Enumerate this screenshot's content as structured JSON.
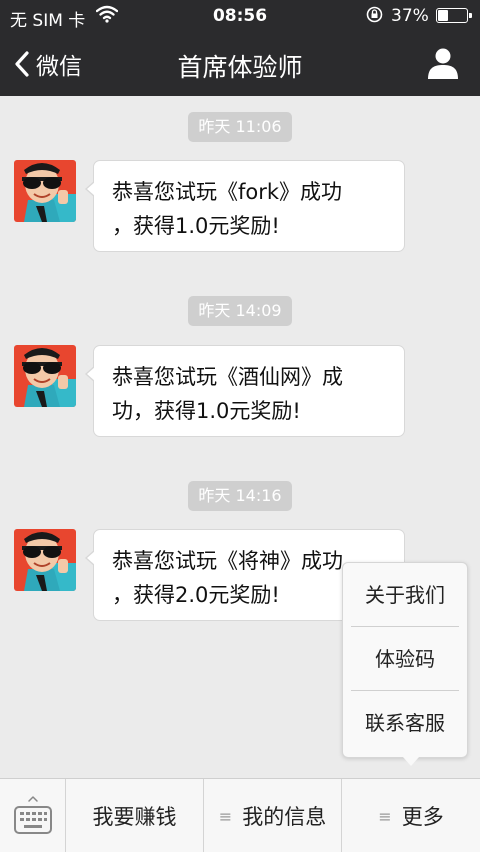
{
  "status_bar": {
    "carrier": "无 SIM 卡",
    "time": "08:56",
    "battery_percent": "37%",
    "battery_level": 0.37
  },
  "nav": {
    "back_label": "微信",
    "title": "首席体验师"
  },
  "messages": [
    {
      "time": "昨天 11:06",
      "line1": "恭喜您试玩《fork》成功",
      "line2": "，获得1.0元奖励!"
    },
    {
      "time": "昨天 14:09",
      "line1": "恭喜您试玩《酒仙网》成",
      "line2": "功，获得1.0元奖励!"
    },
    {
      "time": "昨天 14:16",
      "line1": "恭喜您试玩《将神》成功",
      "line2": "，获得2.0元奖励!"
    }
  ],
  "popup_menu": {
    "items": [
      "关于我们",
      "体验码",
      "联系客服"
    ]
  },
  "bottom_menu": {
    "items": [
      {
        "label": "我要赚钱",
        "icon": ""
      },
      {
        "label": "我的信息",
        "icon": "≡"
      },
      {
        "label": "更多",
        "icon": "≡"
      }
    ]
  },
  "colors": {
    "nav_background": "#2b2b2d",
    "chat_background": "#ebebeb",
    "time_pill": "#cfcfcf"
  }
}
